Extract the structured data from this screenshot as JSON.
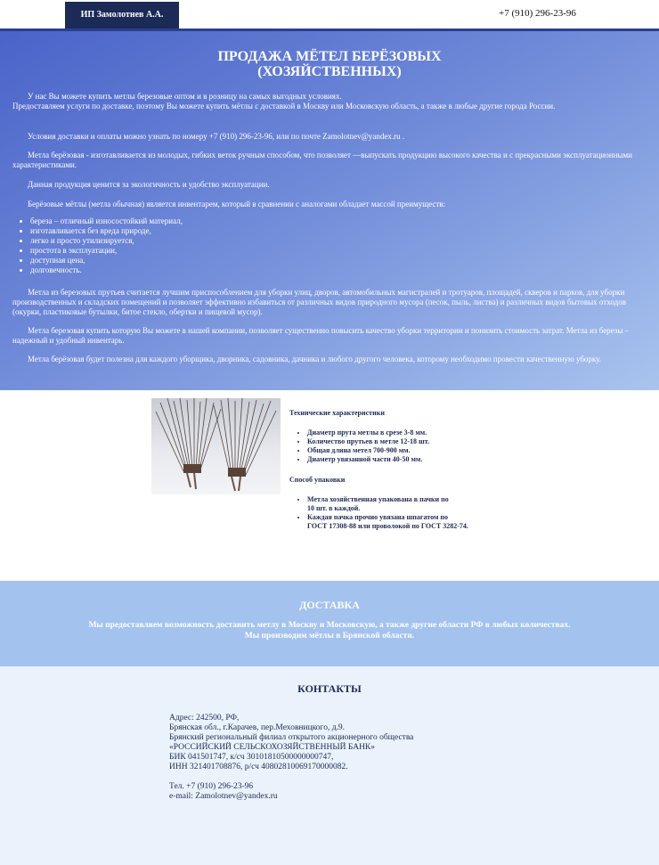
{
  "header": {
    "brand": "ИП Замолотнев А.А.",
    "phone": "+7 (910) 296-23-96"
  },
  "hero": {
    "title_line1": "ПРОДАЖА МЁТЕЛ БЕРЁЗОВЫХ",
    "title_line2": "(ХОЗЯЙСТВЕННЫХ)",
    "p1": "У нас Вы можете купить метлы березовые оптом и в розницу на самых выгодных условиях.",
    "p1b": "Предоставляем услуги по доставке, поэтому Вы можете купить мётлы с доставкой в Москву или Московскую область, а также в любые другие города России.",
    "p2": "Условия доставки и оплаты можно узнать по номеру +7 (910) 296-23-96, или по почте Zamolotnev@yandex.ru .",
    "p3": "Метла берёзовая - изготавливается из молодых, гибких веток ручным способом, что позволяет —выпускать продукцию высокого качества и с прекрасными эксплуатационными характеристиками.",
    "p4": "Данная продукция ценится за экологичность и удобство эксплуатации.",
    "p5": "Берёзовые мётлы (метла обычная) является инвентарем, который в сравнении с аналогами обладает массой преимуществ:",
    "benefits": [
      "береза – отличный износостойкий материал,",
      "изготавливается без вреда природе,",
      "легко и просто утилизируется,",
      "простота в эксплуатации,",
      "доступная цена,",
      "долговечность."
    ],
    "p6": "Метла из березовых прутьев считается лучшим приспособлением для уборки улиц, дворов, автомобильных магистралей и тротуаров, площадей, скверов и парков, для уборки производственных и складских помещений и позволяет эффективно избавиться от различных видов природного мусора (песок, пыль, листва) и различных видов бытовых отходов (окурки, пластиковые бутылки, битое стекло, обертки и пищевой мусор).",
    "p7": "Метла березовая купить которую Вы можете в нашей компании, позволяет существенно повысить качество уборки территории и понизить стоимость затрат. Метла из березы – надежный и удобный инвентарь.",
    "p8": "Метла берёзовая будет полезна для каждого уборщика, дворника, садовника, дачника и любого другого человека, которому необходимо провести качественную уборку."
  },
  "tech": {
    "title": "Технические характеристики",
    "items": [
      "Диаметр прута метлы в срезе 3-8 мм.",
      "Количество прутьев в метле 12-18 шт.",
      "Общая длина метел 700-900 мм.",
      "Диаметр увязанной части 40-50 мм."
    ],
    "pack_title": "Способ упаковки",
    "pack_item1_line1": "Метла хозяйственная упакована в пачки по",
    "pack_item1_line2": "10 шт. в каждой.",
    "pack_item2_line1": "Каждая пачка прочно увязана шпагатом по",
    "pack_item2_line2": "ГОСТ 17308-88 или проволокой по ГОСТ 3282-74."
  },
  "delivery": {
    "title": "ДОСТАВКА",
    "line1": "Мы предоставляем возможность доставить метлу в Москву и Московскую, а также другие области РФ в любых количествах.",
    "line2": "Мы производим мётлы в Брянской области."
  },
  "contacts": {
    "title": "КОНТАКТЫ",
    "lines": [
      "Адрес: 242500, РФ,",
      "Брянская обл., г.Карачев, пер.Меховницкого, д.9.",
      "Брянский региональный филиал открытого акционерного общества",
      "«РОССИЙСКИЙ СЕЛЬСКОХОЗЯЙСТВЕННЫЙ БАНК»",
      "БИК 041501747, к/сч 30101810500000000747,",
      "ИНН 321401708876, р/сч 40802810069170000082."
    ],
    "phone": "Тел. +7 (910) 296-23-96",
    "email": "e-mail: Zamolotnev@yandex.ru"
  },
  "colors": {
    "brand_bg": "#1b2a56",
    "hero_start": "#4a63c9",
    "hero_end": "#a9c4ee",
    "delivery_bg": "#a3c2ee",
    "contacts_bg": "#eaf2fb"
  }
}
